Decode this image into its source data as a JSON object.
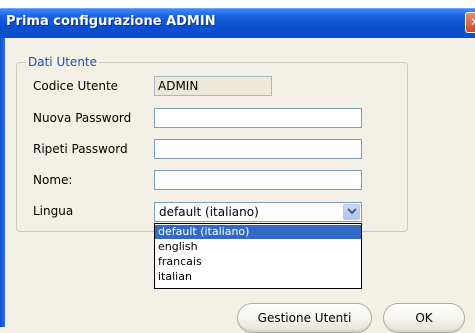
{
  "window": {
    "title": "Prima configurazione ADMIN",
    "close_glyph": "✕"
  },
  "group": {
    "label": "Dati Utente"
  },
  "fields": {
    "codice_utente": {
      "label": "Codice Utente",
      "value": "ADMIN"
    },
    "nuova_password": {
      "label": "Nuova Password",
      "value": ""
    },
    "ripeti_password": {
      "label": "Ripeti Password",
      "value": ""
    },
    "nome": {
      "label": "Nome:",
      "value": ""
    },
    "lingua": {
      "label": "Lingua",
      "selected": "default (italiano)",
      "options": [
        "default (italiano)",
        "english",
        "francais",
        "italian"
      ]
    }
  },
  "buttons": {
    "gestione_utenti": "Gestione Utenti",
    "ok": "OK"
  },
  "colors": {
    "titlebar": "#0a4fd1",
    "group_label": "#1c4fb8",
    "selection": "#316ac5"
  }
}
